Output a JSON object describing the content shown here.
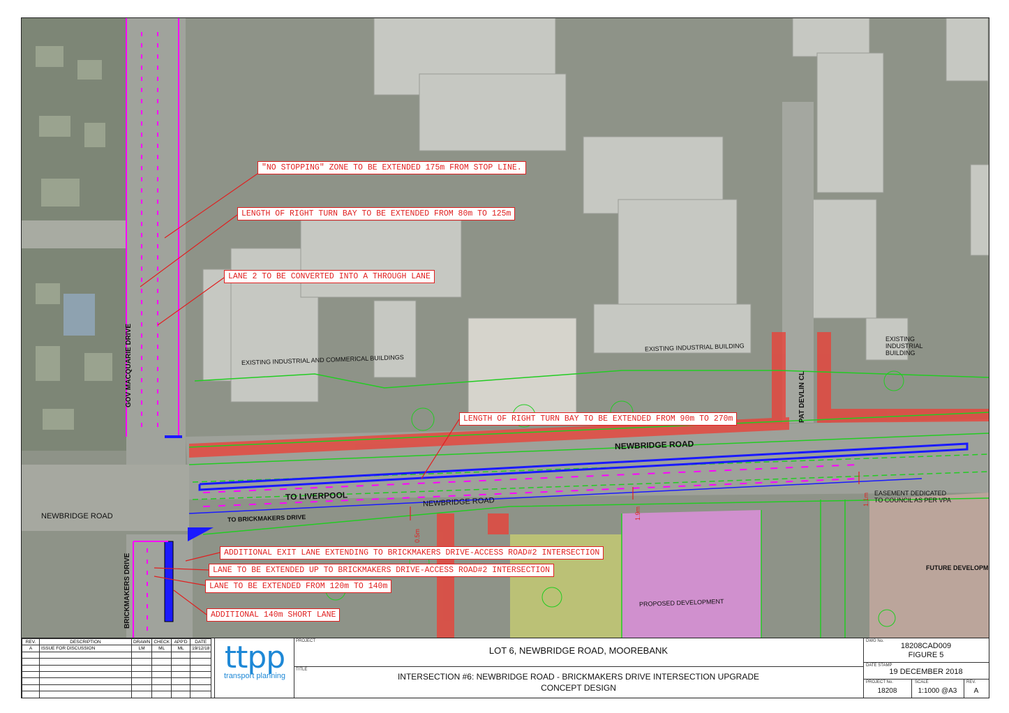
{
  "callouts": {
    "no_stopping": "\"NO STOPPING\" ZONE TO BE EXTENDED 175m FROM STOP LINE.",
    "right_turn_80_125": "LENGTH OF RIGHT TURN BAY TO BE EXTENDED FROM 80m TO 125m",
    "lane2_through": "LANE 2 TO BE CONVERTED INTO A THROUGH LANE",
    "right_turn_90_270": "LENGTH OF RIGHT TURN BAY TO BE EXTENDED FROM 90m TO 270m",
    "additional_exit_lane": "ADDITIONAL EXIT LANE EXTENDING TO  BRICKMAKERS DRIVE-ACCESS ROAD#2 INTERSECTION",
    "lane_extended_access": "LANE TO BE EXTENDED UP TO BRICKMAKERS DRIVE-ACCESS ROAD#2 INTERSECTION",
    "lane_120_140": "LANE TO BE EXTENDED FROM 120m TO 140m",
    "short_lane_140": "ADDITIONAL 140m SHORT LANE"
  },
  "map_labels": {
    "existing_industrial_commercial": "EXISTING INDUSTRIAL AND COMMERICAL BUILDINGS",
    "existing_industrial_building": "EXISTING INDUSTRIAL BUILDING",
    "existing_industrial_building_right": "EXISTING INDUSTRIAL BUILDING",
    "pat_devlin": "PAT DEVLIN CL",
    "gov_macquarie": "GOV MACQUARIE DRIVE",
    "brickmakers": "BRICKMAKERS DRIVE",
    "newbridge_road_main": "NEWBRIDGE ROAD",
    "newbridge_road_left": "NEWBRIDGE ROAD",
    "newbridge_road_lower": "NEWBRIDGE ROAD",
    "to_liverpool": "TO LIVERPOOL",
    "to_brickmakers": "TO BRICKMAKERS DRIVE",
    "easement": "EASEMENT DEDICATED TO COUNCIL AS PER VPA",
    "future_development": "FUTURE DEVELOPMENT",
    "proposed_development": "PROPOSED DEVELOPMENT",
    "dim_05": "0.5m",
    "dim_19": "1.9m",
    "dim_11": "1.1m"
  },
  "title_block": {
    "rev_headers": [
      "REV.",
      "DESCRIPTION",
      "DRAWN",
      "CHECK",
      "APP'D",
      "DATE"
    ],
    "rev_row": [
      "A",
      "ISSUE FOR DISCUSSION",
      "LM",
      "ML",
      "ML",
      "19/12/18"
    ],
    "logo_text": "ttpp",
    "logo_sub": "transport planning",
    "project_label": "PROJECT",
    "project": "LOT 6, NEWBRIDGE ROAD, MOOREBANK",
    "title_label": "TITLE",
    "title_line1": "INTERSECTION #6: NEWBRIDGE ROAD - BRICKMAKERS DRIVE INTERSECTION UPGRADE",
    "title_line2": "CONCEPT DESIGN",
    "dwg_label": "DWG No.",
    "dwg_no": "18208CAD009",
    "figure": "FIGURE 5",
    "date_stamp_label": "DATE STAMP",
    "date_stamp": "19 DECEMBER 2018",
    "project_no_label": "PROJECT No.",
    "project_no": "18208",
    "scale_label": "SCALE",
    "scale": "1:1000 @A3",
    "rev_label": "REV.",
    "rev": "A"
  },
  "colors": {
    "callout_red": "#e02020",
    "magenta_markings": "#ff00ff",
    "green_linework": "#22cc22",
    "blue_lane": "#1a1aff",
    "red_zone": "#e8433a",
    "logo_blue": "#1e88d6"
  }
}
